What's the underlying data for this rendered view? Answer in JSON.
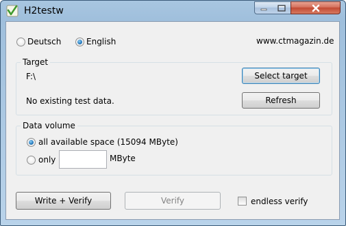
{
  "window": {
    "title": "H2testw",
    "icon": "h2testw-check-icon",
    "controls": [
      "minimize-icon",
      "maximize-icon",
      "close-icon"
    ]
  },
  "language": {
    "options": [
      "Deutsch",
      "English"
    ],
    "selected": "English"
  },
  "website": "www.ctmagazin.de",
  "target": {
    "group_label": "Target",
    "path": "F:\\",
    "status": "No existing test data.",
    "select_button": "Select target",
    "refresh_button": "Refresh"
  },
  "data_volume": {
    "group_label": "Data volume",
    "all_space_label": "all available space (15094 MByte)",
    "only_label": "only",
    "only_value": "",
    "unit_label": "MByte",
    "selected": "all"
  },
  "actions": {
    "write_verify_button": "Write + Verify",
    "verify_button": "Verify",
    "endless_verify_label": "endless verify",
    "endless_verify_checked": false
  },
  "colors": {
    "accent": "#3c7fb1",
    "close": "#c24a34",
    "frame": "#a8c6e0"
  }
}
